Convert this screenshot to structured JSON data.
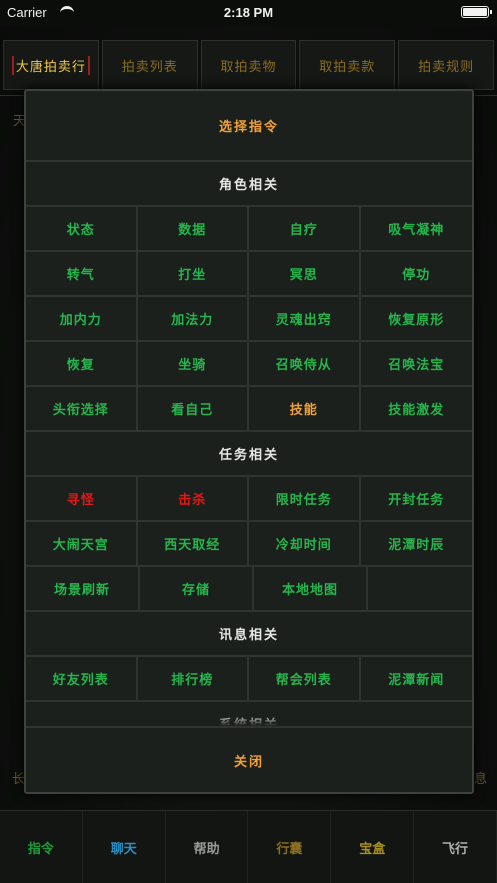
{
  "status_bar": {
    "carrier": "Carrier",
    "time": "2:18 PM"
  },
  "background": {
    "tabs": [
      {
        "label": "大唐拍卖行",
        "active": true
      },
      {
        "label": "拍卖列表",
        "active": false
      },
      {
        "label": "取拍卖物",
        "active": false
      },
      {
        "label": "取拍卖款",
        "active": false
      },
      {
        "label": "拍卖规则",
        "active": false
      }
    ],
    "left_text": "天",
    "left_text2": "长",
    "right_text": "息",
    "bottom_nav": [
      {
        "label": "指令",
        "color": "#1f9a3a"
      },
      {
        "label": "聊天",
        "color": "#2a8ec0"
      },
      {
        "label": "帮助",
        "color": "#9a9a9a"
      },
      {
        "label": "行囊",
        "color": "#8a6d22"
      },
      {
        "label": "宝盒",
        "color": "#a89020"
      },
      {
        "label": "飞行",
        "color": "#b0b0b0"
      }
    ]
  },
  "modal": {
    "title": "选择指令",
    "close_label": "关闭",
    "sections": [
      {
        "header": "角色相关",
        "rows": [
          [
            "状态",
            "数据",
            "自疗",
            "吸气凝神"
          ],
          [
            "转气",
            "打坐",
            "冥思",
            "停功"
          ],
          [
            "加内力",
            "加法力",
            "灵魂出窍",
            "恢复原形"
          ],
          [
            "恢复",
            "坐骑",
            "召唤侍从",
            "召唤法宝"
          ],
          [
            "头衔选择",
            "看自己",
            "技能",
            "技能激发"
          ]
        ]
      },
      {
        "header": "任务相关",
        "rows": [
          [
            "寻怪",
            "击杀",
            "限时任务",
            "开封任务"
          ],
          [
            "大闹天宫",
            "西天取经",
            "冷却时间",
            "泥潭时辰"
          ],
          [
            "场景刷新",
            "存储",
            "本地地图"
          ]
        ]
      },
      {
        "header": "讯息相关",
        "rows": [
          [
            "好友列表",
            "排行榜",
            "帮会列表",
            "泥潭新闻"
          ]
        ]
      }
    ],
    "partial_header": "系统相关",
    "colors": {
      "default_button": "#26b54c",
      "highlight_red": "#e01818",
      "highlight_orange": "#f0a13a"
    },
    "red_items": [
      "寻怪",
      "击杀"
    ],
    "orange_items": [
      "技能"
    ]
  }
}
